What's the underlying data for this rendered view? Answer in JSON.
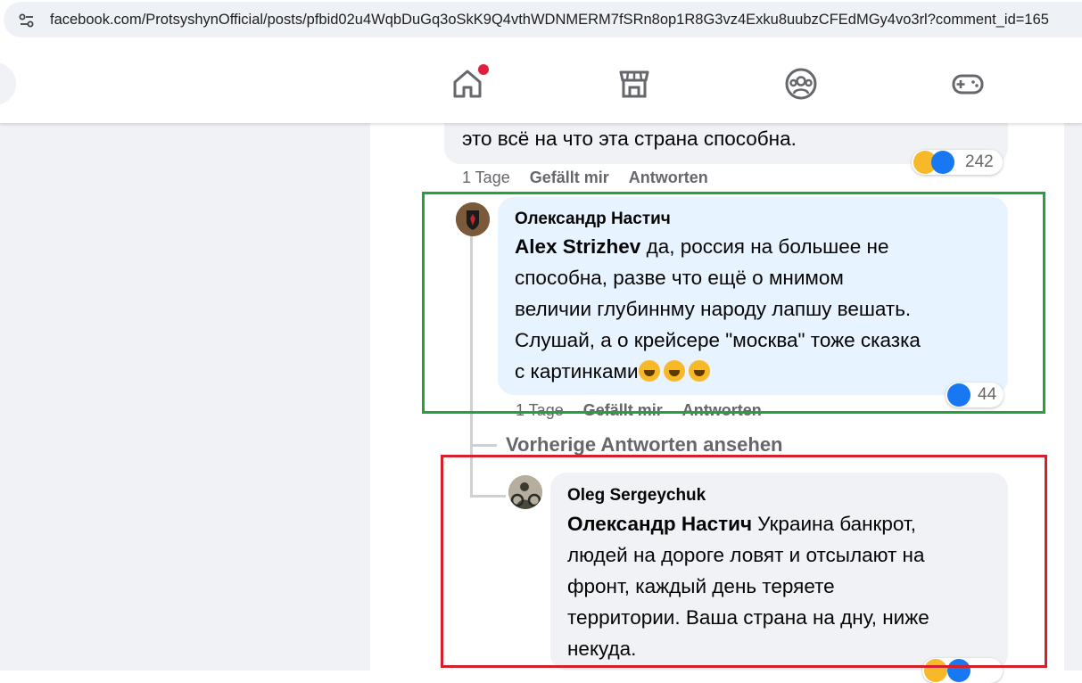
{
  "browser": {
    "url": "facebook.com/ProtsyshynOfficial/posts/pfbid02u4WqbDuGq3oSkK9Q4vthWDNMERM7fSRn8op1R8G3vz4Exku8uubzCFEdMGy4vo3rl?comment_id=165"
  },
  "nav": {
    "icons": [
      "home-icon",
      "marketplace-icon",
      "groups-icon",
      "gaming-icon"
    ]
  },
  "comment_top": {
    "text": "это всё на что эта страна способна.",
    "reactions_count": "242",
    "meta": {
      "age": "1 Tage",
      "like": "Gefällt mir",
      "reply": "Antworten"
    }
  },
  "reply1": {
    "author": "Олександр Настич",
    "mention": "Alex Strizhev",
    "text_lines": [
      " да, россия на большее не",
      "способна, разве что ещё о мнимом",
      "величии глубиннму народу лапшу вешать.",
      "Слушай, а о крейсере \"москва\" тоже сказка",
      "с картинками"
    ],
    "emoji": [
      "😂",
      "😂",
      "😂"
    ],
    "reactions_count": "44",
    "meta": {
      "age": "1 Tage",
      "like": "Gefällt mir",
      "reply": "Antworten"
    }
  },
  "view_previous": "Vorherige Antworten ansehen",
  "reply2": {
    "author": "Oleg Sergeychuk",
    "mention": "Олександр Настич",
    "text_lines": [
      " Украина банкрот,",
      "людей на дороге ловят и отсылают на",
      "фронт, каждый день теряете",
      "территории. Ваша страна на дну, ниже",
      "некуда."
    ]
  },
  "highlight_colors": {
    "green": "#23a23d",
    "red": "#d4202b"
  }
}
